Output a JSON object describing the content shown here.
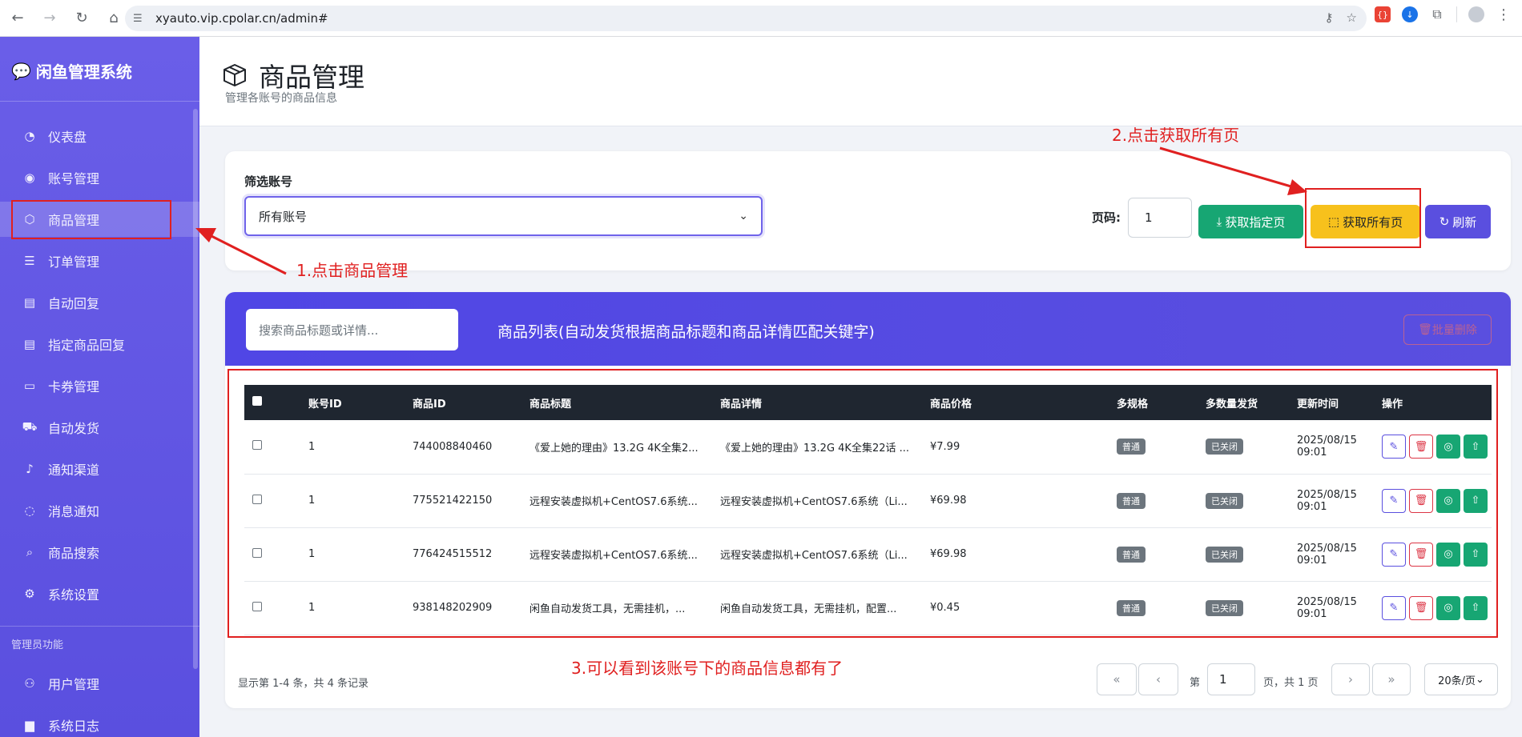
{
  "browser": {
    "url": "xyauto.vip.cpolar.cn/admin#"
  },
  "sidebar": {
    "brand": "闲鱼管理系统",
    "items": [
      {
        "label": "仪表盘",
        "icon": "gauge-icon"
      },
      {
        "label": "账号管理",
        "icon": "user-circle-icon"
      },
      {
        "label": "商品管理",
        "icon": "box-icon"
      },
      {
        "label": "订单管理",
        "icon": "list-icon"
      },
      {
        "label": "自动回复",
        "icon": "message-icon"
      },
      {
        "label": "指定商品回复",
        "icon": "message-icon"
      },
      {
        "label": "卡券管理",
        "icon": "card-icon"
      },
      {
        "label": "自动发货",
        "icon": "truck-icon"
      },
      {
        "label": "通知渠道",
        "icon": "bell-icon"
      },
      {
        "label": "消息通知",
        "icon": "chat-icon"
      },
      {
        "label": "商品搜索",
        "icon": "search-icon"
      },
      {
        "label": "系统设置",
        "icon": "gear-icon"
      }
    ],
    "admin_section": "管理员功能",
    "admin_items": [
      {
        "label": "用户管理",
        "icon": "users-icon"
      },
      {
        "label": "系统日志",
        "icon": "file-icon"
      }
    ]
  },
  "header": {
    "title": "商品管理",
    "subtitle": "管理各账号的商品信息"
  },
  "filter": {
    "label": "筛选账号",
    "selected": "所有账号",
    "page_label": "页码:",
    "page_value": "1",
    "btn_fetch_page": "获取指定页",
    "btn_fetch_all": "获取所有页",
    "btn_refresh": "刷新"
  },
  "list": {
    "search_placeholder": "搜索商品标题或详情...",
    "title": "商品列表(自动发货根据商品标题和商品详情匹配关键字)",
    "bulk_delete": "批量删除",
    "columns": [
      "账号ID",
      "商品ID",
      "商品标题",
      "商品详情",
      "商品价格",
      "多规格",
      "多数量发货",
      "更新时间",
      "操作"
    ],
    "rows": [
      {
        "account_id": "1",
        "item_id": "744008840460",
        "title": "《爱上她的理由》13.2G 4K全集2...",
        "detail": "《爱上她的理由》13.2G 4K全集22话 ...",
        "price": "¥7.99",
        "spec": "普通",
        "multi": "已关闭",
        "date": "2025/08/15",
        "time": "09:01"
      },
      {
        "account_id": "1",
        "item_id": "775521422150",
        "title": "远程安装虚拟机+CentOS7.6系统...",
        "detail": "远程安装虚拟机+CentOS7.6系统（Li...",
        "price": "¥69.98",
        "spec": "普通",
        "multi": "已关闭",
        "date": "2025/08/15",
        "time": "09:01"
      },
      {
        "account_id": "1",
        "item_id": "776424515512",
        "title": "远程安装虚拟机+CentOS7.6系统...",
        "detail": "远程安装虚拟机+CentOS7.6系统（Li...",
        "price": "¥69.98",
        "spec": "普通",
        "multi": "已关闭",
        "date": "2025/08/15",
        "time": "09:01"
      },
      {
        "account_id": "1",
        "item_id": "938148202909",
        "title": "闲鱼自动发货工具，无需挂机，...",
        "detail": "闲鱼自动发货工具，无需挂机，配置...",
        "price": "¥0.45",
        "spec": "普通",
        "multi": "已关闭",
        "date": "2025/08/15",
        "time": "09:01"
      }
    ],
    "footer_info": "显示第 1-4 条，共 4 条记录",
    "pager_prefix": "第",
    "pager_page": "1",
    "pager_suffix": "页，共 1 页",
    "page_size": "20条/页"
  },
  "annotations": {
    "step1": "1.点击商品管理",
    "step2": "2.点击获取所有页",
    "step3": "3.可以看到该账号下的商品信息都有了"
  },
  "colors": {
    "sidebar": "#5a4fdf",
    "accent": "#5a4fdf",
    "green": "#17a673",
    "yellow": "#f7c11c",
    "annotation": "#e02020"
  }
}
